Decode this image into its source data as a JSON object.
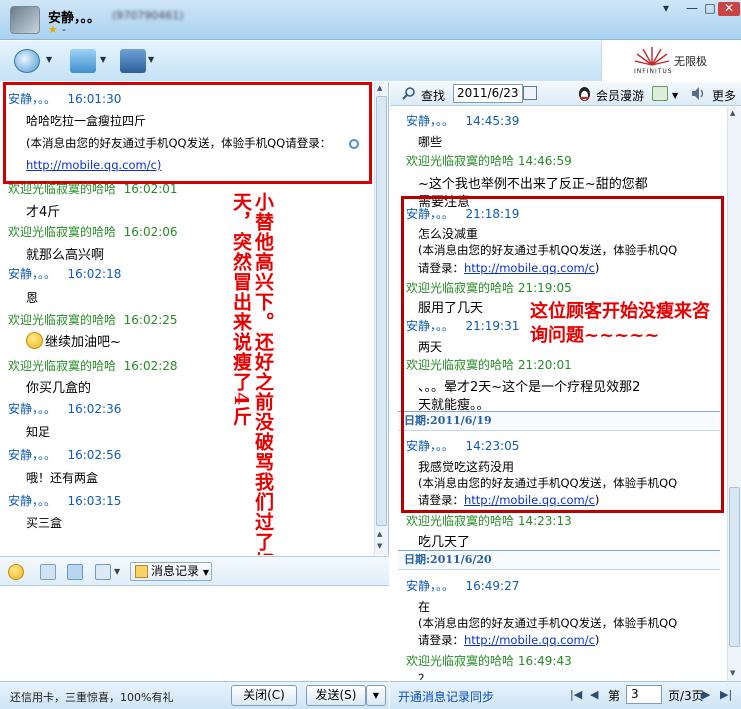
{
  "window": {
    "contact_name": "安静，。。",
    "contact_id": "(970790461)",
    "status": "-"
  },
  "ad": {
    "cn": "无限极",
    "en": "INFINITUS"
  },
  "left_chat": {
    "messages": [
      {
        "sender": "安静，。。",
        "time": "16:01:30",
        "lines": [
          "哈哈吃拉一盒瘦拉四斤",
          "(本消息由您的好友通过手机QQ发送，体验手机QQ请登录：",
          "http://mobile.qq.com/c)"
        ]
      },
      {
        "sender": "欢迎光临寂寞的哈哈",
        "time": "16:02:01",
        "lines": [
          "才4斤"
        ]
      },
      {
        "sender": "欢迎光临寂寞的哈哈",
        "time": "16:02:06",
        "lines": [
          "就那么高兴啊"
        ]
      },
      {
        "sender": "安静，。。",
        "time": "16:02:18",
        "lines": [
          "恩"
        ]
      },
      {
        "sender": "欢迎光临寂寞的哈哈",
        "time": "16:02:25",
        "lines": [
          "继续加油吧~"
        ]
      },
      {
        "sender": "欢迎光临寂寞的哈哈",
        "time": "16:02:28",
        "lines": [
          "你买几盒的"
        ]
      },
      {
        "sender": "安静，。。",
        "time": "16:02:36",
        "lines": [
          "知足"
        ]
      },
      {
        "sender": "安静，。。",
        "time": "16:02:56",
        "lines": [
          "哦！还有两盒"
        ]
      },
      {
        "sender": "安静，。。",
        "time": "16:03:15",
        "lines": [
          "买三盒"
        ]
      }
    ],
    "annotation": "小替他高兴下。还好之前没破骂我们过了好多天，突然冒出来说瘦了4斤"
  },
  "left_tools": {
    "history_button": "消息记录"
  },
  "statusbar": {
    "ad_text": "还信用卡，三重惊喜，100%有礼",
    "close_button": "关闭(C)",
    "send_button": "发送(S)"
  },
  "right_panel": {
    "search_label": "查找",
    "date_value": "2011/6/23",
    "member_label": "会员漫游",
    "more_label": "更多",
    "history": {
      "h1": {
        "sender": "安静，。。",
        "time": "14:45:39"
      },
      "t1": "哪些",
      "h2": {
        "sender": "欢迎光临寂寞的哈哈",
        "time": "14:46:59"
      },
      "t2a": "~这个我也举例不出来了反正~甜的您都",
      "t2b": "需要注意",
      "h3": {
        "sender": "安静，。。",
        "time": "21:18:19"
      },
      "t3a": "怎么没减重",
      "t3b": "(本消息由您的好友通过手机QQ发送，体验手机QQ",
      "t3c": "请登录：",
      "link": "http://mobile.qq.com/c",
      "close_paren": ")",
      "h4": {
        "sender": "欢迎光临寂寞的哈哈",
        "time": "21:19:05"
      },
      "t4": "服用了几天",
      "h5": {
        "sender": "安静，。。",
        "time": "21:19:31"
      },
      "t5": "两天",
      "h6": {
        "sender": "欢迎光临寂寞的哈哈",
        "time": "21:20:01"
      },
      "t6a": "、。。晕才2天~这个是一个疗程见效那2",
      "t6b": "天就能瘦。。",
      "date1": "日期:2011/6/19",
      "h7": {
        "sender": "安静，。。",
        "time": "14:23:05"
      },
      "t7a": "我感觉吃这药没用",
      "t7b": "(本消息由您的好友通过手机QQ发送，体验手机QQ",
      "t7c": "请登录：",
      "h8": {
        "sender": "欢迎光临寂寞的哈哈",
        "time": "14:23:13"
      },
      "t8": "吃几天了",
      "date2": "日期:2011/6/20",
      "h9": {
        "sender": "安静，。。",
        "time": "16:49:27"
      },
      "t9a": "在",
      "t9b": "(本消息由您的好友通过手机QQ发送，体验手机QQ",
      "t9c": "请登录：",
      "h10": {
        "sender": "欢迎光临寂寞的哈哈",
        "time": "16:49:43"
      },
      "t10": "？"
    },
    "annotation": "这位顾客开始没瘦来咨询问题~~~~~",
    "sync_link": "开通消息记录同步",
    "page_label": "第",
    "page_value": "3",
    "page_total": "页/3页"
  }
}
